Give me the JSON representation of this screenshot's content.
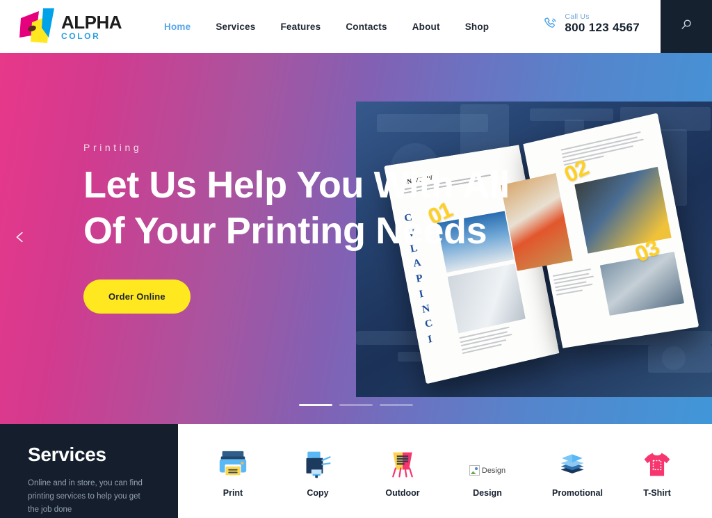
{
  "header": {
    "logo": {
      "name": "ALPHA",
      "sub": "COLOR"
    },
    "nav": [
      {
        "label": "Home",
        "active": true
      },
      {
        "label": "Services",
        "active": false
      },
      {
        "label": "Features",
        "active": false
      },
      {
        "label": "Contacts",
        "active": false
      },
      {
        "label": "About",
        "active": false
      },
      {
        "label": "Shop",
        "active": false
      }
    ],
    "contact": {
      "icon": "phone-icon",
      "label": "Call Us",
      "number": "800 123 4567"
    },
    "search": {
      "icon": "search-icon",
      "background": "#16212f"
    }
  },
  "hero": {
    "eyebrow": "Printing",
    "title": "Let Us Help You With All Of Your Printing Needs",
    "cta": "Order Online",
    "prev_arrow": "chevron-left-icon",
    "gradient_from": "#e8388a",
    "gradient_to": "#4097d8",
    "cta_color": "#ffe81f",
    "slides": [
      {
        "active": true
      },
      {
        "active": false
      },
      {
        "active": false
      }
    ],
    "image": {
      "headline": "ON VIEW",
      "vertical_word": "CVLAPINCI",
      "markers": [
        "01",
        "02",
        "03"
      ],
      "marker_color": "#ffd024"
    }
  },
  "services": {
    "title": "Services",
    "description": "Online and in store, you can find printing services to help you get the job done",
    "background": "#141e2c",
    "items": [
      {
        "label": "Print",
        "icon": "printer-icon",
        "broken": false
      },
      {
        "label": "Copy",
        "icon": "copier-icon",
        "broken": false
      },
      {
        "label": "Outdoor",
        "icon": "sign-board-icon",
        "broken": false
      },
      {
        "label": "Design",
        "icon": "broken-image-icon",
        "broken": true
      },
      {
        "label": "Promotional",
        "icon": "stacked-sheets-icon",
        "broken": false
      },
      {
        "label": "T-Shirt",
        "icon": "tshirt-icon",
        "broken": false
      }
    ]
  }
}
